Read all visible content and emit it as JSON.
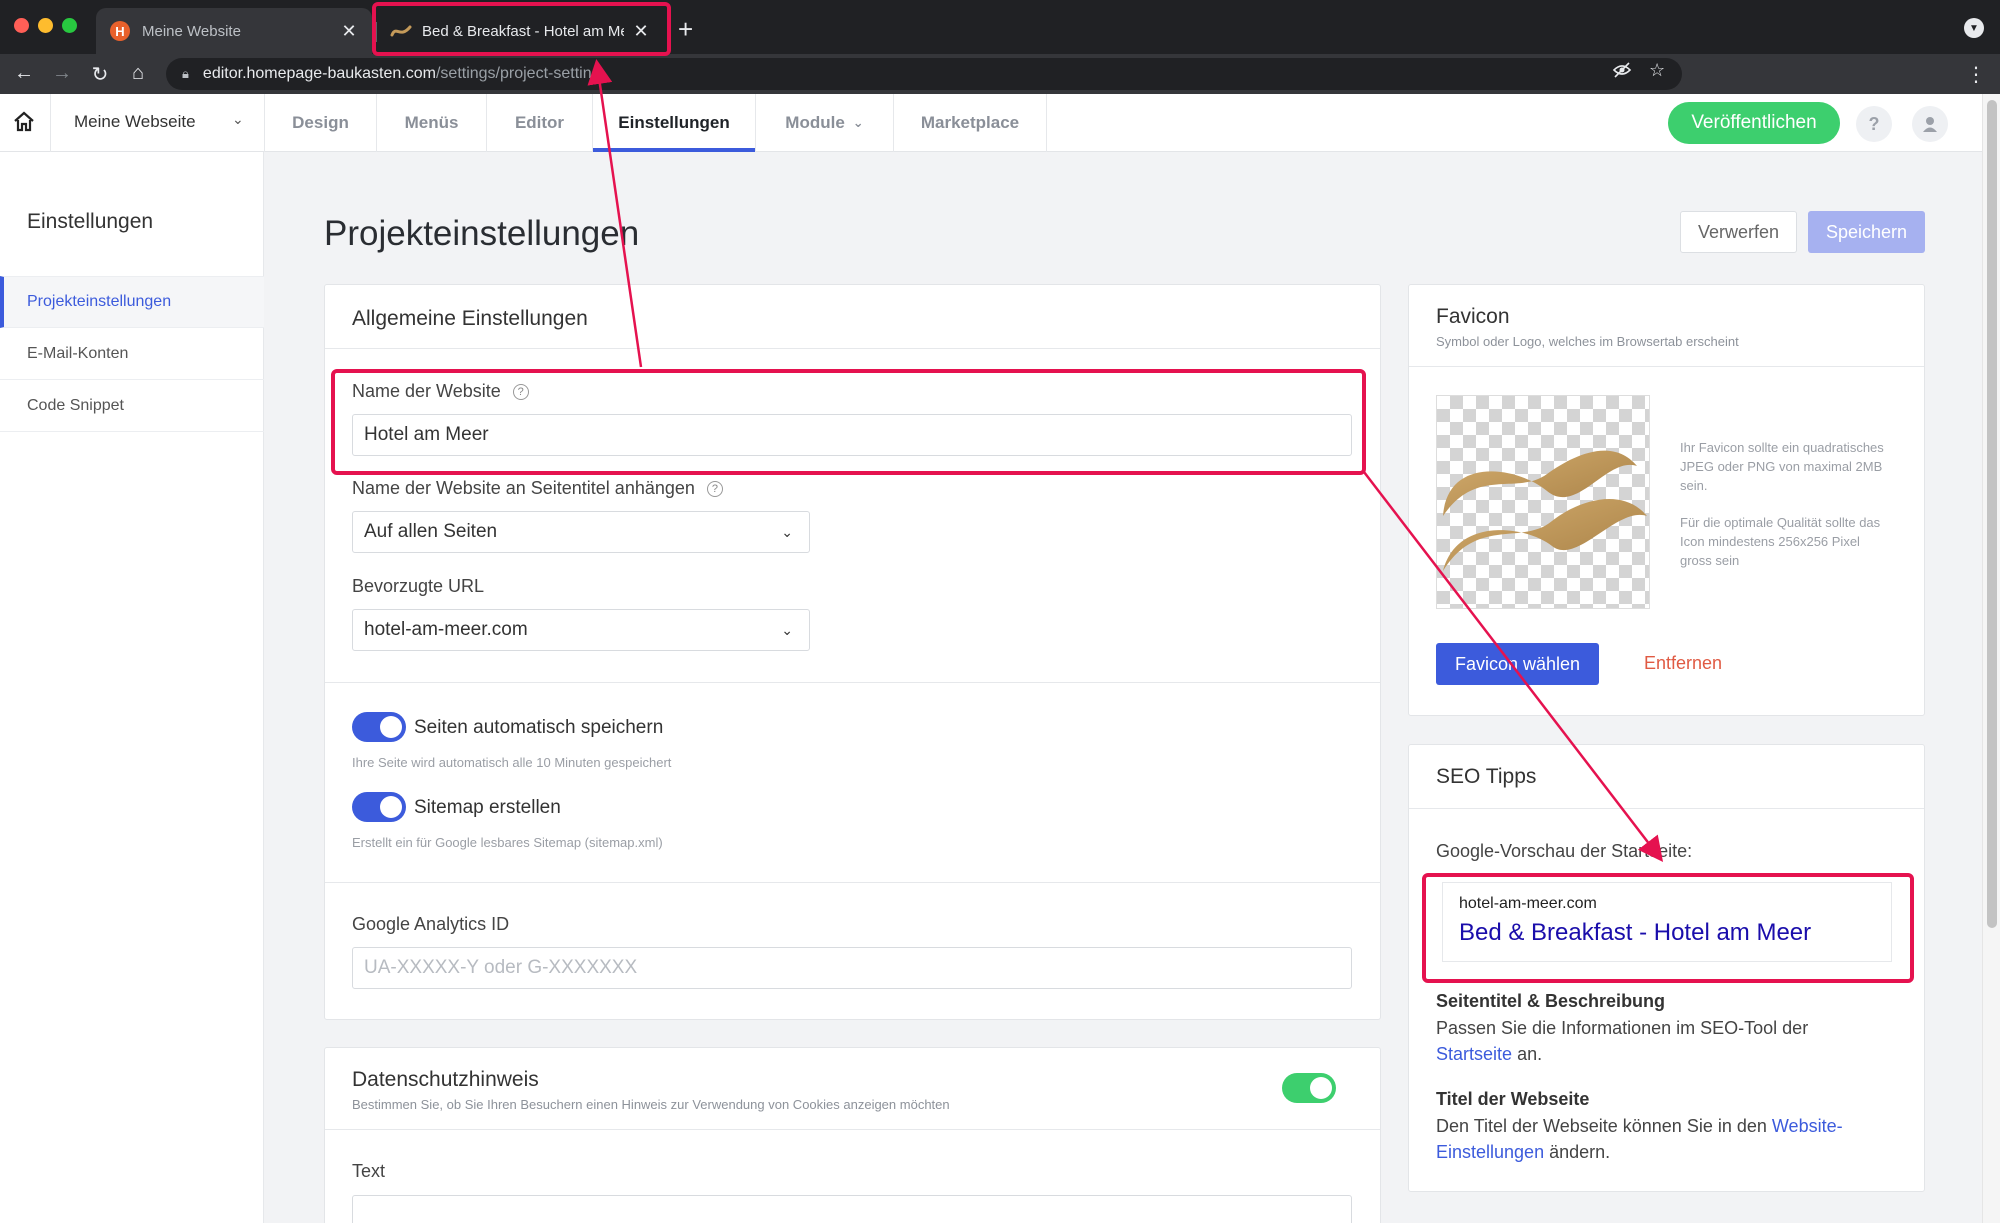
{
  "browser": {
    "tabs": [
      {
        "title": "Meine Website",
        "icon": "h-favicon-icon",
        "active": false
      },
      {
        "title": "Bed & Breakfast - Hotel am Meer",
        "icon": "wave-favicon-icon",
        "active": true
      }
    ],
    "url_host": "editor.homepage-baukasten.com",
    "url_path": "/settings/project-setting"
  },
  "header": {
    "site_select": "Meine Webseite",
    "nav": [
      "Design",
      "Menüs",
      "Editor",
      "Einstellungen",
      "Module",
      "Marketplace"
    ],
    "active_nav": "Einstellungen",
    "publish_label": "Veröffentlichen",
    "help_label": "?"
  },
  "sidebar": {
    "title": "Einstellungen",
    "items": [
      {
        "label": "Projekteinstellungen",
        "active": true
      },
      {
        "label": "E-Mail-Konten",
        "active": false
      },
      {
        "label": "Code Snippet",
        "active": false
      }
    ]
  },
  "main": {
    "title": "Projekteinstellungen",
    "discard_label": "Verwerfen",
    "save_label": "Speichern",
    "general": {
      "title": "Allgemeine Einstellungen",
      "site_name_label": "Name der Website",
      "site_name_value": "Hotel am Meer",
      "append_label": "Name der Website an Seitentitel anhängen",
      "append_value": "Auf allen Seiten",
      "url_label": "Bevorzugte URL",
      "url_value": "hotel-am-meer.com",
      "autosave_label": "Seiten automatisch speichern",
      "autosave_hint": "Ihre Seite wird automatisch alle 10 Minuten gespeichert",
      "autosave_on": true,
      "sitemap_label": "Sitemap erstellen",
      "sitemap_hint": "Erstellt ein für Google lesbares Sitemap (sitemap.xml)",
      "sitemap_on": true,
      "analytics_label": "Google Analytics ID",
      "analytics_placeholder": "UA-XXXXX-Y oder G-XXXXXXX"
    },
    "privacy": {
      "title": "Datenschutzhinweis",
      "subtitle": "Bestimmen Sie, ob Sie Ihren Besuchern einen Hinweis zur Verwendung von Cookies anzeigen möchten",
      "enabled": true,
      "text_label": "Text"
    }
  },
  "favicon": {
    "title": "Favicon",
    "subtitle": "Symbol oder Logo, welches im Browsertab erscheint",
    "info1": "Ihr Favicon sollte ein quadratisches JPEG oder PNG von maximal 2MB sein.",
    "info2": "Für die optimale Qualität sollte das Icon mindestens 256x256 Pixel gross sein",
    "choose_label": "Favicon wählen",
    "remove_label": "Entfernen"
  },
  "seo": {
    "title": "SEO Tipps",
    "preview_label": "Google-Vorschau der Startseite:",
    "preview_url": "hotel-am-meer.com",
    "preview_title": "Bed & Breakfast - Hotel am Meer",
    "h1": "Seitentitel & Beschreibung",
    "p1_before": "Passen Sie die Informationen im SEO-Tool der",
    "p1_link": "Startseite",
    "p1_after": "an.",
    "h2": "Titel der Webseite",
    "p2_before": "Den Titel der Webseite können Sie in den",
    "p2_link": "Website-Einstellungen",
    "p2_after": "ändern."
  },
  "colors": {
    "accent": "#3c5bdc",
    "publish": "#3dcf6e",
    "annotation": "#e5124f",
    "remove": "#e05a43"
  }
}
